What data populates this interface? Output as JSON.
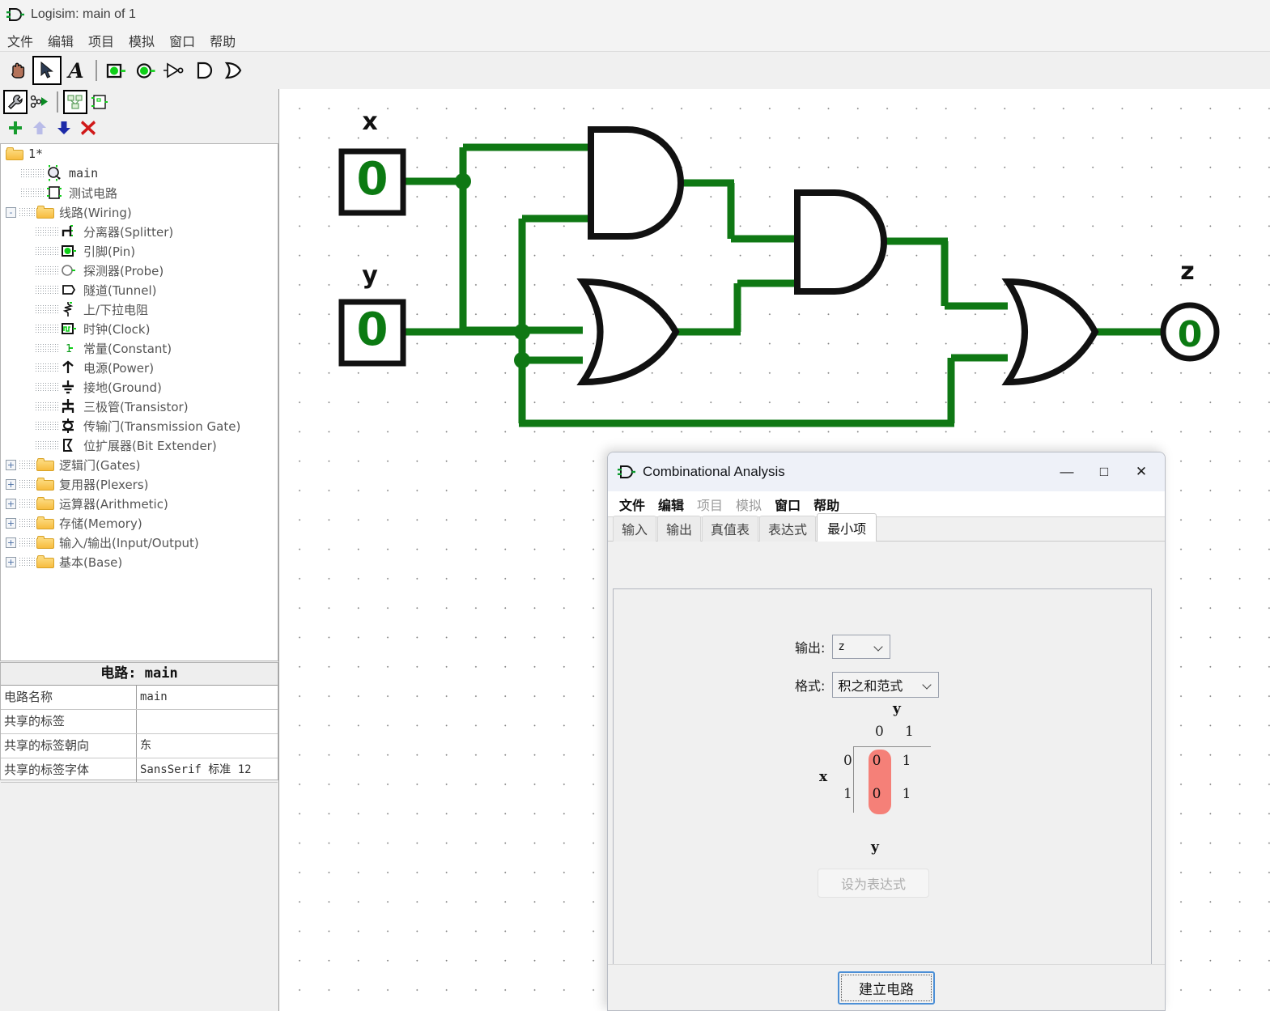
{
  "window": {
    "title": "Logisim: main of 1",
    "icon": "logisim-gate-icon"
  },
  "menubar": {
    "items": [
      "文件",
      "编辑",
      "项目",
      "模拟",
      "窗口",
      "帮助"
    ]
  },
  "toolbar": {
    "row1": [
      {
        "name": "poke-tool",
        "label": "poke-hand-icon",
        "selected": false
      },
      {
        "name": "select-tool",
        "label": "arrow-cursor-icon",
        "selected": true
      },
      {
        "name": "text-tool",
        "label": "text-A-icon",
        "selected": false
      },
      {
        "name": "pin-input-tool",
        "label": "pin-input-icon",
        "selected": false
      },
      {
        "name": "pin-output-tool",
        "label": "pin-output-icon",
        "selected": false
      },
      {
        "name": "not-gate-tool",
        "label": "not-gate-icon",
        "selected": false
      },
      {
        "name": "and-gate-tool",
        "label": "and-gate-icon",
        "selected": false
      },
      {
        "name": "or-gate-tool",
        "label": "or-gate-icon",
        "selected": false
      }
    ],
    "row2": [
      {
        "name": "edit-tool",
        "label": "wrench-icon",
        "selected": true
      },
      {
        "name": "simulate-tool",
        "label": "sim-run-icon",
        "selected": false
      },
      {
        "name": "subcircuit-tool",
        "label": "subcircuit-icon",
        "selected": true
      },
      {
        "name": "add-circuit-tool",
        "label": "new-circuit-icon",
        "selected": false
      }
    ],
    "row3": [
      {
        "name": "add-button",
        "label": "plus-icon",
        "enabled": true
      },
      {
        "name": "move-up-button",
        "label": "arrow-up-icon",
        "enabled": false
      },
      {
        "name": "move-down-button",
        "label": "arrow-down-icon",
        "enabled": true
      },
      {
        "name": "delete-button",
        "label": "red-x-icon",
        "enabled": true
      }
    ]
  },
  "explorer": {
    "items": [
      {
        "depth": 0,
        "label": "1*",
        "icon": "folder-icon",
        "handle": "",
        "mono": true
      },
      {
        "depth": 1,
        "label": "main",
        "icon": "circuit-main-icon",
        "handle": "",
        "mono": true
      },
      {
        "depth": 1,
        "label": "测试电路",
        "icon": "circuit-icon",
        "handle": "",
        "mono": false
      },
      {
        "depth": 0,
        "label": "线路(Wiring)",
        "icon": "folder-icon",
        "handle": "-",
        "mono": false
      },
      {
        "depth": 2,
        "label": "分离器(Splitter)",
        "icon": "splitter-icon",
        "handle": "",
        "mono": false
      },
      {
        "depth": 2,
        "label": "引脚(Pin)",
        "icon": "pin-icon",
        "handle": "",
        "mono": false
      },
      {
        "depth": 2,
        "label": "探测器(Probe)",
        "icon": "probe-icon",
        "handle": "",
        "mono": false
      },
      {
        "depth": 2,
        "label": "隧道(Tunnel)",
        "icon": "tunnel-icon",
        "handle": "",
        "mono": false
      },
      {
        "depth": 2,
        "label": "上/下拉电阻",
        "icon": "pull-resistor-icon",
        "handle": "",
        "mono": false
      },
      {
        "depth": 2,
        "label": "时钟(Clock)",
        "icon": "clock-icon",
        "handle": "",
        "mono": false
      },
      {
        "depth": 2,
        "label": "常量(Constant)",
        "icon": "constant-icon",
        "handle": "",
        "mono": false
      },
      {
        "depth": 2,
        "label": "电源(Power)",
        "icon": "power-icon",
        "handle": "",
        "mono": false
      },
      {
        "depth": 2,
        "label": "接地(Ground)",
        "icon": "ground-icon",
        "handle": "",
        "mono": false
      },
      {
        "depth": 2,
        "label": "三极管(Transistor)",
        "icon": "transistor-icon",
        "handle": "",
        "mono": false
      },
      {
        "depth": 2,
        "label": "传输门(Transmission Gate)",
        "icon": "transmission-gate-icon",
        "handle": "",
        "mono": false
      },
      {
        "depth": 2,
        "label": "位扩展器(Bit Extender)",
        "icon": "bit-extender-icon",
        "handle": "",
        "mono": false
      },
      {
        "depth": 0,
        "label": "逻辑门(Gates)",
        "icon": "folder-icon",
        "handle": "+",
        "mono": false
      },
      {
        "depth": 0,
        "label": "复用器(Plexers)",
        "icon": "folder-icon",
        "handle": "+",
        "mono": false
      },
      {
        "depth": 0,
        "label": "运算器(Arithmetic)",
        "icon": "folder-icon",
        "handle": "+",
        "mono": false
      },
      {
        "depth": 0,
        "label": "存储(Memory)",
        "icon": "folder-icon",
        "handle": "+",
        "mono": false
      },
      {
        "depth": 0,
        "label": "输入/输出(Input/Output)",
        "icon": "folder-icon",
        "handle": "+",
        "mono": false
      },
      {
        "depth": 0,
        "label": "基本(Base)",
        "icon": "folder-icon",
        "handle": "+",
        "mono": false
      }
    ]
  },
  "properties": {
    "header": "电路: main",
    "rows": [
      {
        "key": "电路名称",
        "value": "main"
      },
      {
        "key": "共享的标签",
        "value": ""
      },
      {
        "key": "共享的标签朝向",
        "value": "东"
      },
      {
        "key": "共享的标签字体",
        "value": "SansSerif 标准 12"
      }
    ]
  },
  "canvas": {
    "wire_color": "#0f7814",
    "input_x": {
      "label": "x",
      "value": "0"
    },
    "input_y": {
      "label": "y",
      "value": "0"
    },
    "output_z": {
      "label": "z",
      "value": "0"
    },
    "gates": [
      {
        "name": "and-gate-1",
        "type": "AND"
      },
      {
        "name": "or-gate-1",
        "type": "OR"
      },
      {
        "name": "and-gate-2",
        "type": "AND"
      },
      {
        "name": "or-gate-2",
        "type": "OR"
      }
    ]
  },
  "dialog": {
    "title": "Combinational Analysis",
    "icon": "logisim-gate-icon",
    "window_controls": {
      "minimize": "—",
      "maximize": "□",
      "close": "✕"
    },
    "menubar": [
      "文件",
      "编辑",
      "项目",
      "模拟",
      "窗口",
      "帮助"
    ],
    "tabs": [
      {
        "label": "输入",
        "active": false
      },
      {
        "label": "输出",
        "active": false
      },
      {
        "label": "真值表",
        "active": false
      },
      {
        "label": "表达式",
        "active": false
      },
      {
        "label": "最小项",
        "active": true
      }
    ],
    "output_label": "输出:",
    "output_value": "z",
    "format_label": "格式:",
    "format_value": "积之和范式",
    "set_expression_button": "设为表达式",
    "build_circuit_button": "建立电路",
    "kmap": {
      "top_var": "y",
      "left_var": "x",
      "col_headers": [
        "0",
        "1"
      ],
      "row_headers": [
        "0",
        "1"
      ],
      "cells": [
        [
          "0",
          "1"
        ],
        [
          "0",
          "1"
        ]
      ],
      "highlight_color": "#f58078",
      "highlight": {
        "col": 1,
        "rows": [
          0,
          1
        ]
      },
      "expression": "y"
    }
  }
}
